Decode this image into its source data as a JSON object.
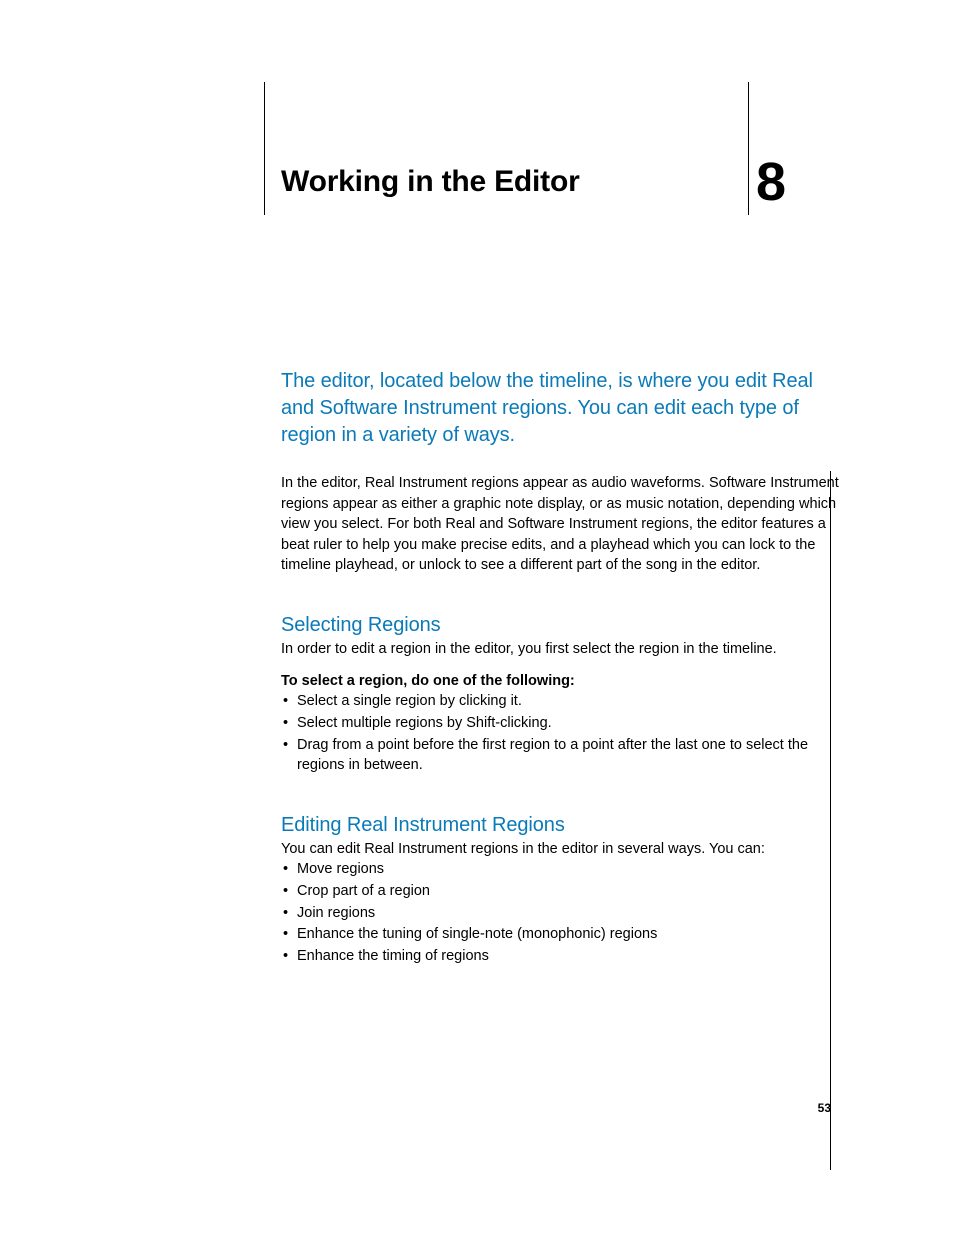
{
  "chapter": {
    "title": "Working in the Editor",
    "number": "8"
  },
  "intro": "The editor, located below the timeline, is where you edit Real and Software Instrument regions. You can edit each type of region in a variety of ways.",
  "para1": "In the editor, Real Instrument regions appear as audio waveforms. Software Instrument regions appear as either a graphic note display, or as music notation, depending which view you select. For both Real and Software Instrument regions, the editor features a beat ruler to help you make precise edits, and a playhead which you can lock to the timeline playhead, or unlock to see a different part of the song in the editor.",
  "section1": {
    "heading": "Selecting Regions",
    "para": "In order to edit a region in the editor, you first select the region in the timeline.",
    "lead": "To select a region, do one of the following:",
    "items": [
      "Select a single region by clicking it.",
      "Select multiple regions by Shift-clicking.",
      "Drag from a point before the first region to a point after the last one to select the regions in between."
    ]
  },
  "section2": {
    "heading": "Editing Real Instrument Regions",
    "para": "You can edit Real Instrument regions in the editor in several ways. You can:",
    "items": [
      "Move regions",
      "Crop part of a region",
      "Join regions",
      "Enhance the tuning of single-note (monophonic) regions",
      "Enhance the timing of regions"
    ]
  },
  "pageNumber": "53"
}
